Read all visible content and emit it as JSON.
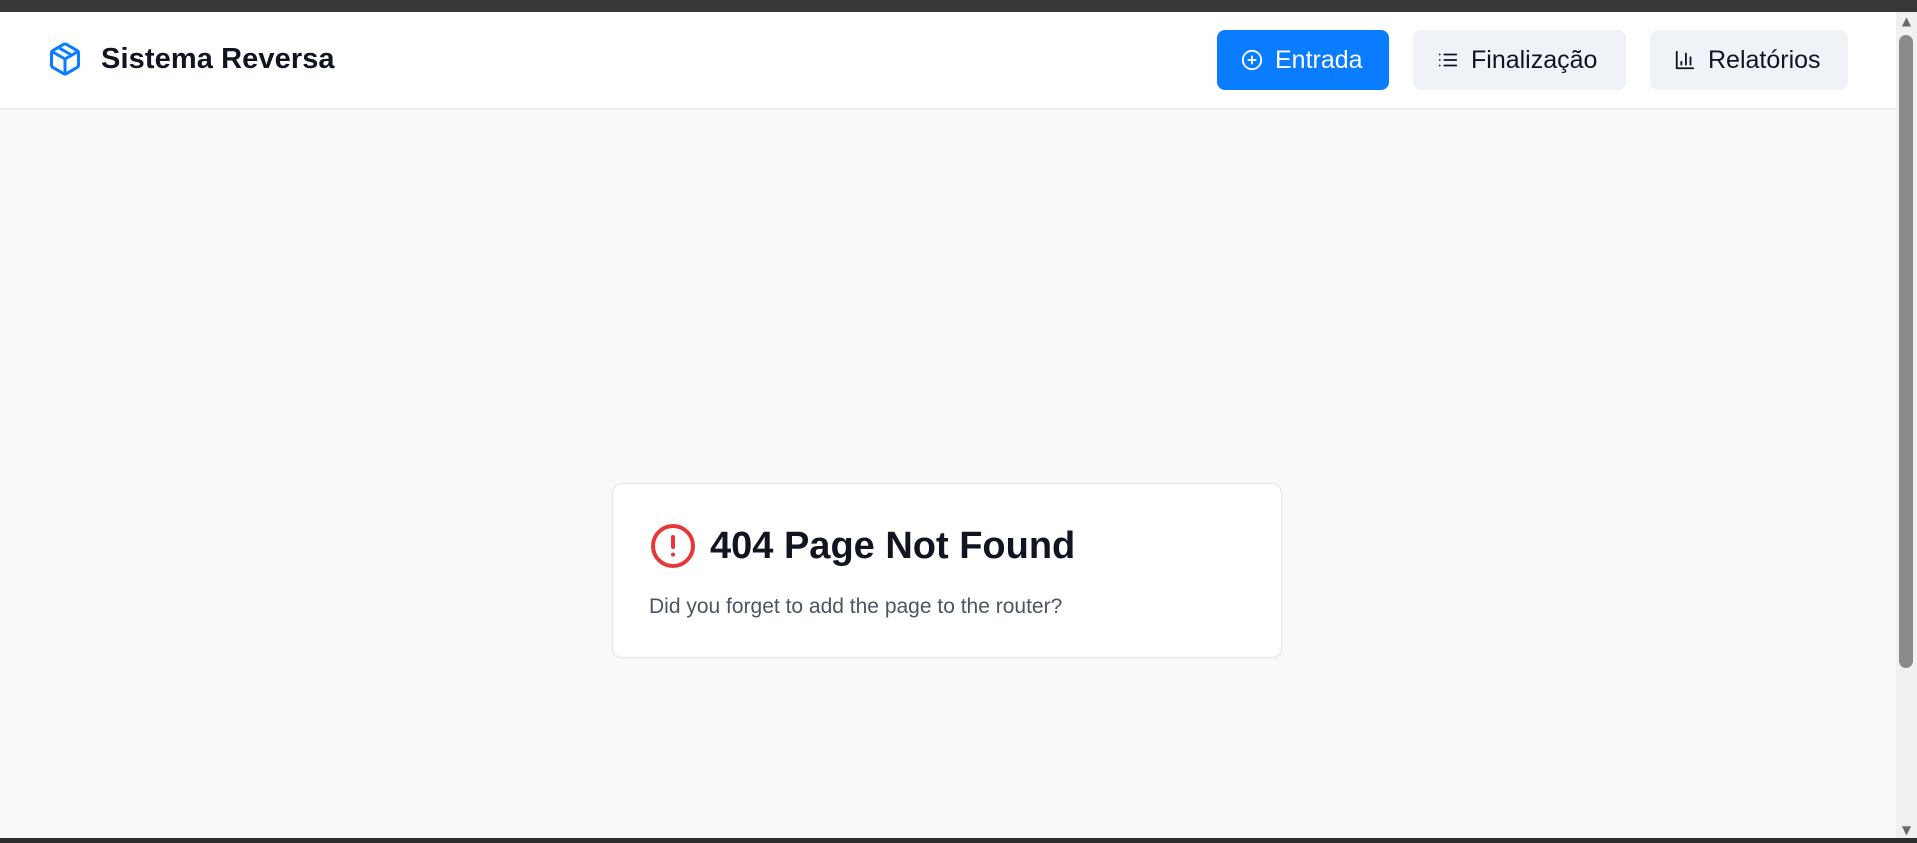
{
  "header": {
    "brand_title": "Sistema Reversa",
    "brand_icon": "package-icon",
    "nav": [
      {
        "label": "Entrada",
        "icon": "plus-circle-icon",
        "variant": "primary"
      },
      {
        "label": "Finalização",
        "icon": "list-icon",
        "variant": "secondary"
      },
      {
        "label": "Relatórios",
        "icon": "bar-chart-icon",
        "variant": "secondary"
      }
    ]
  },
  "main": {
    "error_card": {
      "icon": "alert-circle-icon",
      "title": "404 Page Not Found",
      "message": "Did you forget to add the page to the router?"
    }
  },
  "colors": {
    "accent": "#0a7cff",
    "error": "#e5383b",
    "background": "#f8f9fb",
    "text": "#111522",
    "muted_text": "#4b5563",
    "secondary_button": "#eff2f6"
  }
}
